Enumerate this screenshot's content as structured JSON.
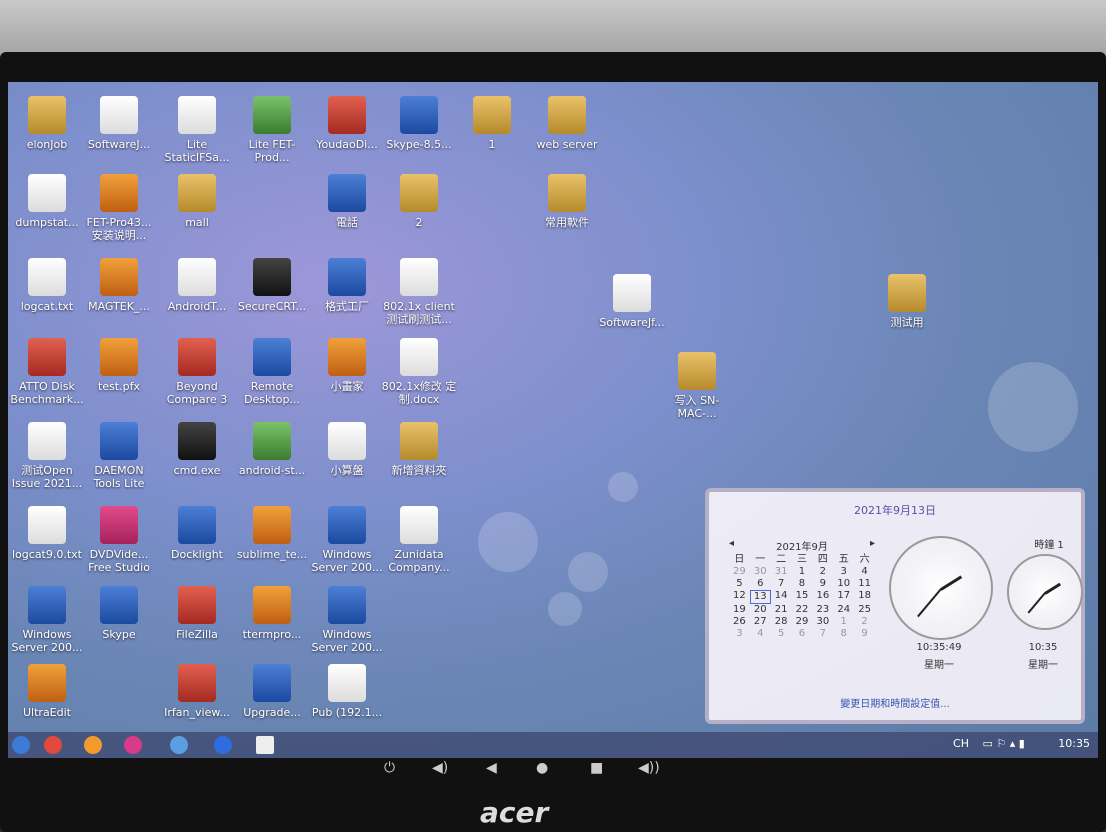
{
  "desktop_icons": [
    {
      "label": "elonJob",
      "type": "folder"
    },
    {
      "label": "SoftwareJ...",
      "type": "doc"
    },
    {
      "label": "Lite StaticIFSa...",
      "type": "doc"
    },
    {
      "label": "Lite FET-Prod...",
      "type": "green"
    },
    {
      "label": "YoudaoDi...",
      "type": "red"
    },
    {
      "label": "Skype-8.5...",
      "type": "app"
    },
    {
      "label": "1",
      "type": "folder"
    },
    {
      "label": "web server",
      "type": "folder"
    },
    {
      "label": "dumpstat...",
      "type": "doc"
    },
    {
      "label": "FET-Pro43... 安装说明...",
      "type": "orange"
    },
    {
      "label": "mall",
      "type": "folder"
    },
    {
      "label": "電話",
      "type": "app"
    },
    {
      "label": "2",
      "type": "folder"
    },
    {
      "label": "常用軟件",
      "type": "folder"
    },
    {
      "label": "logcat.txt",
      "type": "doc"
    },
    {
      "label": "MAGTEK_...",
      "type": "orange"
    },
    {
      "label": "AndroidT...",
      "type": "doc"
    },
    {
      "label": "SecureCRT...",
      "type": "dark"
    },
    {
      "label": "格式工厂",
      "type": "app"
    },
    {
      "label": "802.1x client 测试刷测试...",
      "type": "doc"
    },
    {
      "label": "SoftwareJf...",
      "type": "doc"
    },
    {
      "label": "测试用",
      "type": "folder"
    },
    {
      "label": "ATTO Disk Benchmark...",
      "type": "red"
    },
    {
      "label": "test.pfx",
      "type": "orange"
    },
    {
      "label": "Beyond Compare 3",
      "type": "red"
    },
    {
      "label": "Remote Desktop...",
      "type": "app"
    },
    {
      "label": "小畫家",
      "type": "orange"
    },
    {
      "label": "802.1x修改 定制.docx",
      "type": "doc"
    },
    {
      "label": "写入 SN-MAC-...",
      "type": "folder"
    },
    {
      "label": "测试Open Issue 2021...",
      "type": "doc"
    },
    {
      "label": "DAEMON Tools Lite",
      "type": "app"
    },
    {
      "label": "cmd.exe",
      "type": "dark"
    },
    {
      "label": "android-st...",
      "type": "green"
    },
    {
      "label": "小算盤",
      "type": "doc"
    },
    {
      "label": "新增資料夾",
      "type": "folder"
    },
    {
      "label": "logcat9.0.txt",
      "type": "doc"
    },
    {
      "label": "DVDVide... Free Studio",
      "type": "pink"
    },
    {
      "label": "Docklight",
      "type": "app"
    },
    {
      "label": "sublime_te...",
      "type": "orange"
    },
    {
      "label": "Windows Server 200...",
      "type": "app"
    },
    {
      "label": "Zunidata Company...",
      "type": "doc"
    },
    {
      "label": "Windows Server 200...",
      "type": "app"
    },
    {
      "label": "Skype",
      "type": "app"
    },
    {
      "label": "FileZilla",
      "type": "red"
    },
    {
      "label": "ttermpro...",
      "type": "orange"
    },
    {
      "label": "Windows Server 200...",
      "type": "app"
    },
    {
      "label": "UltraEdit",
      "type": "orange"
    },
    {
      "label": "Irfan_view...",
      "type": "red"
    },
    {
      "label": "Upgrade...",
      "type": "app"
    },
    {
      "label": "Pub (192.1...",
      "type": "doc"
    }
  ],
  "clock_popup": {
    "full_date": "2021年9月13日",
    "calendar": {
      "month_label": "2021年9月",
      "prev": "◂",
      "next": "▸",
      "weekdays": [
        "日",
        "一",
        "二",
        "三",
        "四",
        "五",
        "六"
      ],
      "rows": [
        [
          "29",
          "30",
          "31",
          "1",
          "2",
          "3",
          "4"
        ],
        [
          "5",
          "6",
          "7",
          "8",
          "9",
          "10",
          "11"
        ],
        [
          "12",
          "13",
          "14",
          "15",
          "16",
          "17",
          "18"
        ],
        [
          "19",
          "20",
          "21",
          "22",
          "23",
          "24",
          "25"
        ],
        [
          "26",
          "27",
          "28",
          "29",
          "30",
          "1",
          "2"
        ],
        [
          "3",
          "4",
          "5",
          "6",
          "7",
          "8",
          "9"
        ]
      ],
      "today": "13"
    },
    "clock1": {
      "time": "10:35:49",
      "day": "星期一"
    },
    "clock2": {
      "label": "時鐘 1",
      "time": "10:35",
      "day": "星期一"
    },
    "link": "變更日期和時間設定值..."
  },
  "taskbar": {
    "tray_lang": "CH",
    "tray_time": "10:35"
  },
  "monitor": {
    "brand": "acer",
    "buttons": [
      "⏻",
      "◀)",
      "◀",
      "●",
      "■",
      "◀))"
    ]
  }
}
